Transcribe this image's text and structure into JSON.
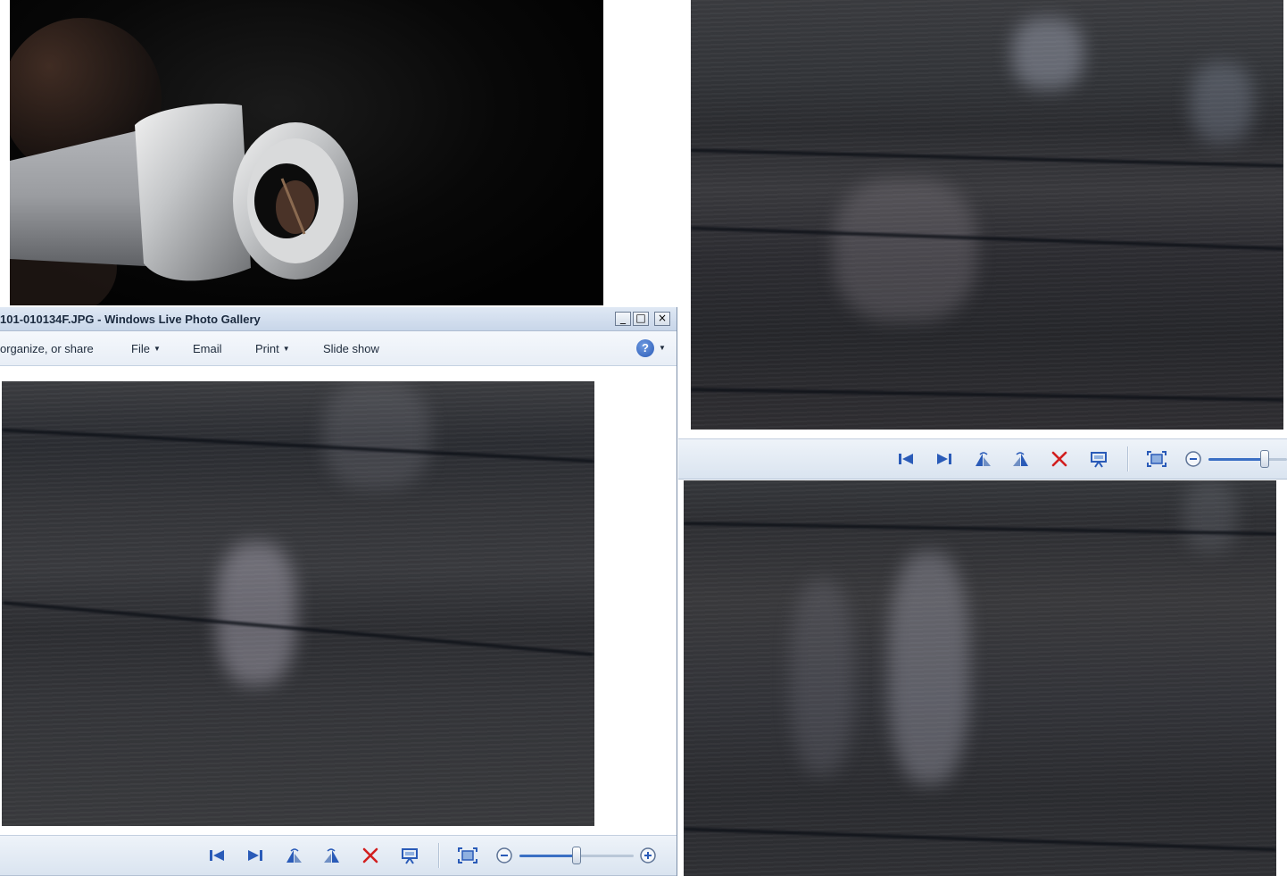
{
  "window": {
    "title": "101-010134F.JPG - Windows Live Photo Gallery",
    "controls": {
      "minimize": "_",
      "maximize": "□",
      "close": "×"
    }
  },
  "menu": {
    "fix_label": "organize, or share",
    "file_label": "File",
    "email_label": "Email",
    "print_label": "Print",
    "slideshow_label": "Slide show",
    "help_label": "?"
  },
  "toolbar": {
    "zoom_level_main": 0.5,
    "zoom_level_right": 0.72,
    "icons": [
      "previous-icon",
      "next-icon",
      "rotate-left-icon",
      "rotate-right-icon",
      "delete-icon",
      "slideshow-icon",
      "fit-to-window-icon",
      "zoom-out-icon",
      "zoom-in-icon"
    ]
  },
  "colors": {
    "accent": "#2a5bb8",
    "delete": "#d21f1f",
    "toolbar": "#dae4f0",
    "titlebar": "#c8d6e9"
  },
  "photos": [
    "barrel-photo",
    "scan-topright",
    "scan-main",
    "scan-bottomright"
  ]
}
